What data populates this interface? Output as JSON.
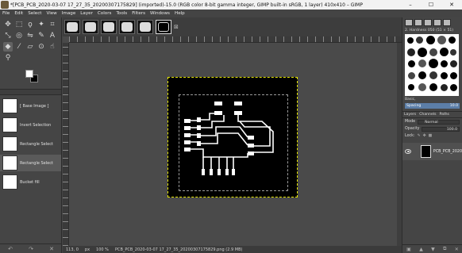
{
  "window": {
    "title": "*[PCB_PCB_2020-03-07 17_27_35_20200307175829] (imported)-15.0 (RGB color 8-bit gamma integer, GIMP built-in sRGB, 1 layer) 410x410 – GIMP",
    "minimize": "–",
    "maximize": "☐",
    "close": "✕"
  },
  "menu": [
    "File",
    "Edit",
    "Select",
    "View",
    "Image",
    "Layer",
    "Colors",
    "Tools",
    "Filters",
    "Windows",
    "Help"
  ],
  "history": {
    "items": [
      {
        "label": "[ Base Image ]"
      },
      {
        "label": "Invert Selection"
      },
      {
        "label": "Rectangle Select"
      },
      {
        "label": "Rectangle Select"
      },
      {
        "label": "Bucket fill"
      }
    ],
    "active_index": 3
  },
  "status": {
    "coords": "113, 0",
    "unit": "px",
    "zoom": "100 %",
    "file": "PCB_PCB_2020-03-07 17_27_35_20200307175829.png (2.9 MB)"
  },
  "brushes": {
    "name": "2. Hardness 050 (51 × 51)",
    "category": "Basic,",
    "spacing_label": "Spacing",
    "spacing_value": "10.0"
  },
  "layers": {
    "tabs": [
      "Layers",
      "Channels",
      "Paths"
    ],
    "mode_label": "Mode",
    "mode_value": "Normal",
    "opacity_label": "Opacity",
    "opacity_value": "100.0",
    "lock_label": "Lock:",
    "layer_name": "PCB_PCB_2020"
  },
  "icons": {
    "tools": [
      "move-icon",
      "rect-select-icon",
      "lasso-icon",
      "fuzzy-select-icon",
      "crop-icon",
      "transform-icon",
      "warp-icon",
      "flip-icon",
      "paths-icon",
      "text-icon",
      "bucket-fill-icon",
      "paintbrush-icon",
      "eraser-icon",
      "clone-icon",
      "smudge-icon",
      "zoom-icon"
    ]
  }
}
